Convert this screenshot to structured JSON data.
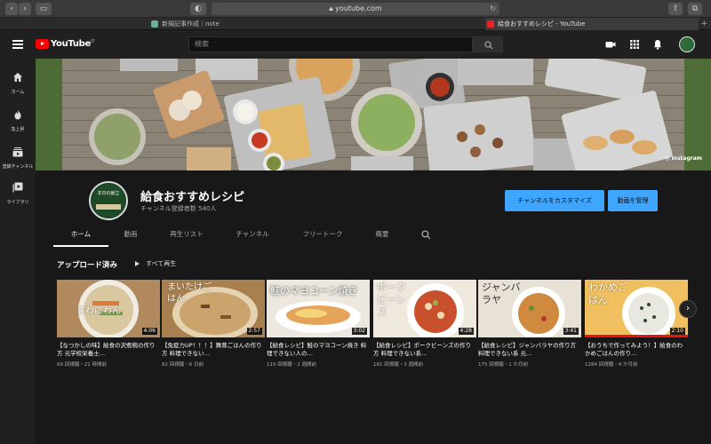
{
  "browser": {
    "url": "youtube.com",
    "tabs": [
      {
        "title": "新規記事作成｜note"
      },
      {
        "title": "給食おすすめレシピ - YouTube"
      }
    ]
  },
  "header": {
    "logo_text": "YouTube",
    "region": "JP",
    "search_placeholder": "検索"
  },
  "guide": {
    "items": [
      {
        "label": "ホーム",
        "icon": "home-icon"
      },
      {
        "label": "急上昇",
        "icon": "flame-icon"
      },
      {
        "label": "登録チャンネル",
        "icon": "subscriptions-icon"
      },
      {
        "label": "ライブラリ",
        "icon": "library-icon"
      }
    ]
  },
  "banner": {
    "badge": "Instagram"
  },
  "channel": {
    "name": "給食おすすめレシピ",
    "subscribers": "チャンネル登録者数 540人",
    "avatar_text": "本日の献立",
    "customize_label": "チャンネルをカスタマイズ",
    "manage_label": "動画を管理",
    "tabs": [
      "ホーム",
      "動画",
      "再生リスト",
      "チャンネル",
      "フリートーク",
      "概要"
    ]
  },
  "section": {
    "title": "アップロード済み",
    "play_all": "すべて再生"
  },
  "videos": [
    {
      "title": "【なつかしの味】給食の沢煮椀の作り方 元学校栄養士…",
      "meta": "69 回視聴・21 時間前",
      "duration": "4:06",
      "overlay": "さわにわん"
    },
    {
      "title": "【免疫力UP！！！】舞茸ごはんの作り方 料理できない…",
      "meta": "82 回視聴・6 日前",
      "duration": "2:57",
      "overlay": "まいたけごはん"
    },
    {
      "title": "【給食レシピ】鮭のマヨコーン焼き 料理できない人の…",
      "meta": "119 回視聴・2 週間前",
      "duration": "3:02",
      "overlay": "鮭のマヨコーン焼き"
    },
    {
      "title": "【給食レシピ】ポークビーンズの作り方 料理できない系…",
      "meta": "181 回視聴・3 週間前",
      "duration": "4:28",
      "overlay": "ポークビーンズ"
    },
    {
      "title": "【給食レシピ】ジャンバラヤの作り方 料理できない系 元…",
      "meta": "175 回視聴・1 か月前",
      "duration": "3:41",
      "overlay": "ジャンバラヤ"
    },
    {
      "title": "【おうちで作ってみよう！】給食のわかめごはんの作り…",
      "meta": "1284 回視聴・4 か月前",
      "duration": "2:10",
      "overlay": "わかめごはん"
    }
  ]
}
